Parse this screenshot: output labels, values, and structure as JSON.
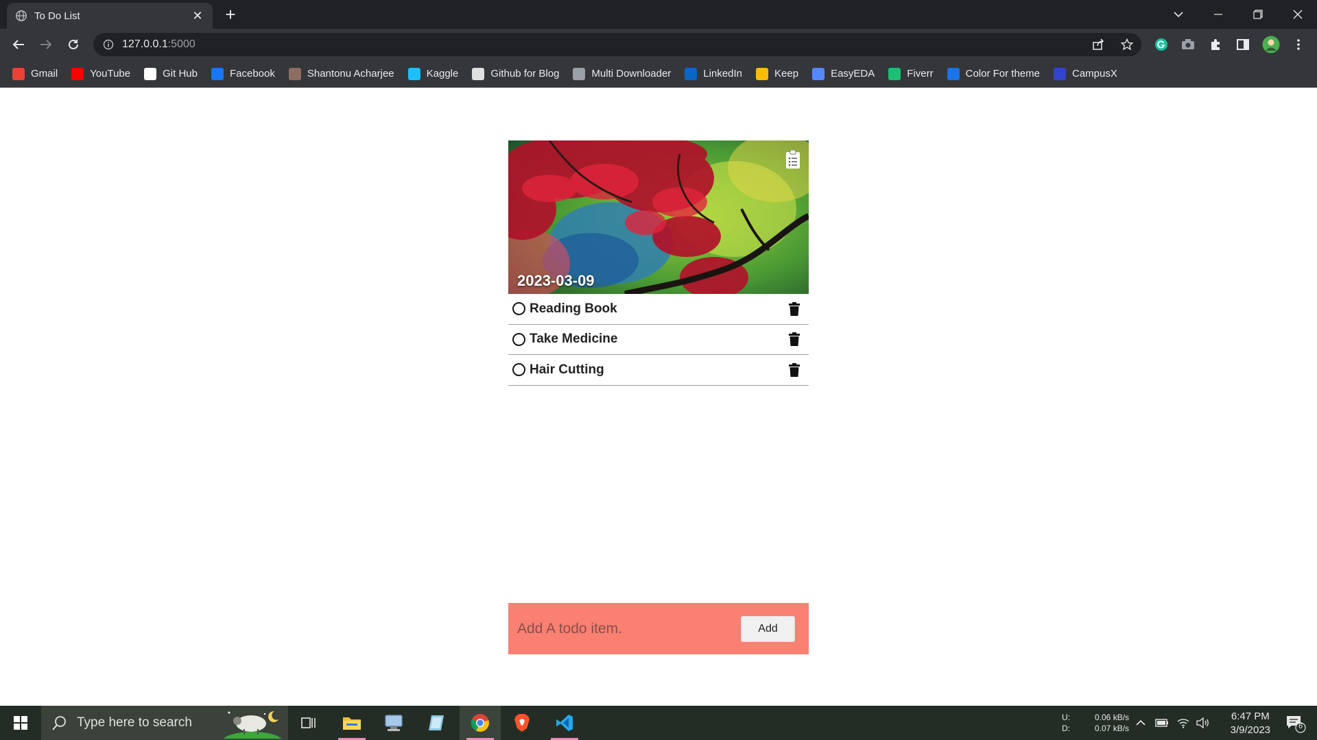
{
  "browser": {
    "tab_title": "To Do List",
    "url_host": "127.0.0.1",
    "url_port": ":5000",
    "bookmarks": [
      {
        "label": "Gmail",
        "icon": "gmail-icon",
        "color": "#ea4335"
      },
      {
        "label": "YouTube",
        "icon": "youtube-icon",
        "color": "#ff0000"
      },
      {
        "label": "Git Hub",
        "icon": "github-icon",
        "color": "#ffffff"
      },
      {
        "label": "Facebook",
        "icon": "facebook-icon",
        "color": "#1877f2"
      },
      {
        "label": "Shantonu Acharjee",
        "icon": "profile-icon",
        "color": "#8d6e63"
      },
      {
        "label": "Kaggle",
        "icon": "kaggle-icon",
        "color": "#20beff"
      },
      {
        "label": "Github for Blog",
        "icon": "code-icon",
        "color": "#e0e0e0"
      },
      {
        "label": "Multi Downloader",
        "icon": "globe-icon",
        "color": "#9aa0a6"
      },
      {
        "label": "LinkedIn",
        "icon": "linkedin-icon",
        "color": "#0a66c2"
      },
      {
        "label": "Keep",
        "icon": "keep-icon",
        "color": "#fbbc04"
      },
      {
        "label": "EasyEDA",
        "icon": "easyeda-icon",
        "color": "#5588ff"
      },
      {
        "label": "Fiverr",
        "icon": "fiverr-icon",
        "color": "#1dbf73"
      },
      {
        "label": "Color For theme",
        "icon": "color-theme-icon",
        "color": "#1a73e8"
      },
      {
        "label": "CampusX",
        "icon": "campusx-icon",
        "color": "#3344cc"
      }
    ]
  },
  "app": {
    "date": "2023-03-09",
    "todos": [
      {
        "text": "Reading Book"
      },
      {
        "text": "Take Medicine"
      },
      {
        "text": "Hair Cutting"
      }
    ],
    "input_placeholder": "Add A todo item.",
    "add_label": "Add",
    "accent_color": "#fa8072"
  },
  "taskbar": {
    "search_placeholder": "Type here to search",
    "upload_label": "U:",
    "download_label": "D:",
    "upload_speed": "0.06 kB/s",
    "download_speed": "0.07 kB/s",
    "time": "6:47 PM",
    "date": "3/9/2023",
    "notification_count": "6"
  }
}
